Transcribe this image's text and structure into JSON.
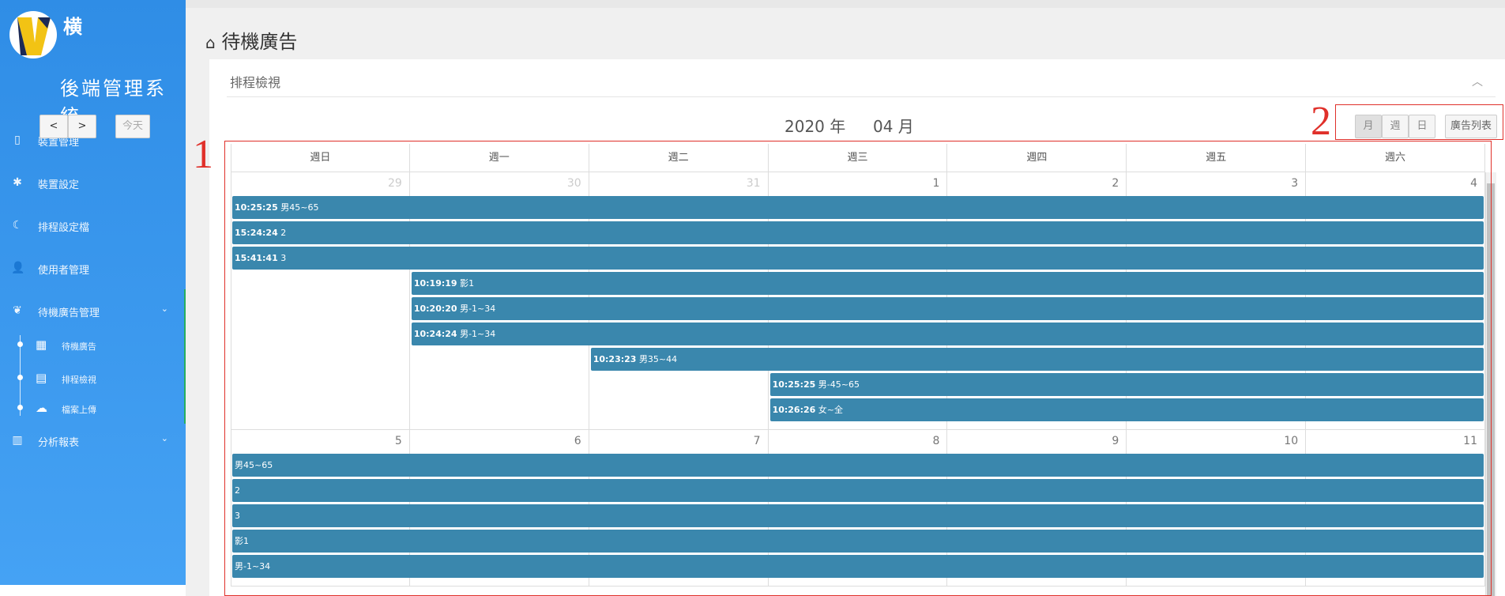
{
  "sidebar": {
    "logo_name": "横",
    "system_title": "後端管理系統",
    "menu": [
      {
        "label": "裝置管理",
        "icon": "tablet-icon"
      },
      {
        "label": "裝置設定",
        "icon": "gear-icon"
      },
      {
        "label": "排程設定檔",
        "icon": "moon-icon"
      },
      {
        "label": "使用者管理",
        "icon": "user-icon"
      },
      {
        "label": "待機廣告管理",
        "icon": "leaf-icon",
        "expanded": true
      },
      {
        "label": "分析報表",
        "icon": "bar-chart-icon"
      }
    ],
    "submenu": [
      {
        "label": "待機廣告",
        "icon": "film-icon"
      },
      {
        "label": "排程檢視",
        "icon": "calendar-icon",
        "active": true
      },
      {
        "label": "檔案上傳",
        "icon": "cloud-upload-icon"
      }
    ]
  },
  "page": {
    "title": "待機廣告"
  },
  "panel": {
    "title": "排程檢視"
  },
  "toolbar": {
    "prev": "<",
    "next": ">",
    "today": "今天",
    "year": "2020 年",
    "month": "04 月",
    "view_month": "月",
    "view_week": "週",
    "view_day": "日",
    "ad_list": "廣告列表"
  },
  "calendar": {
    "weekdays": [
      "週日",
      "週一",
      "週二",
      "週三",
      "週四",
      "週五",
      "週六"
    ],
    "weeks": [
      {
        "days": [
          "29",
          "30",
          "31",
          "1",
          "2",
          "3",
          "4"
        ],
        "events": [
          {
            "time": "10:25:25",
            "title": "男45~65",
            "start": 0
          },
          {
            "time": "15:24:24",
            "title": "2",
            "start": 0
          },
          {
            "time": "15:41:41",
            "title": "3",
            "start": 0
          },
          {
            "time": "10:19:19",
            "title": "影1",
            "start": 1
          },
          {
            "time": "10:20:20",
            "title": "男-1~34",
            "start": 1
          },
          {
            "time": "10:24:24",
            "title": "男-1~34",
            "start": 1
          },
          {
            "time": "10:23:23",
            "title": "男35~44",
            "start": 2
          },
          {
            "time": "10:25:25",
            "title": "男-45~65",
            "start": 3
          },
          {
            "time": "10:26:26",
            "title": "女~全",
            "start": 3
          }
        ]
      },
      {
        "days": [
          "5",
          "6",
          "7",
          "8",
          "9",
          "10",
          "11"
        ],
        "events": [
          {
            "time": "",
            "title": "男45~65",
            "start": 0
          },
          {
            "time": "",
            "title": "2",
            "start": 0
          },
          {
            "time": "",
            "title": "3",
            "start": 0
          },
          {
            "time": "",
            "title": "影1",
            "start": 0
          },
          {
            "time": "",
            "title": "男-1~34",
            "start": 0
          }
        ]
      }
    ]
  },
  "annotations": [
    {
      "label": "1"
    },
    {
      "label": "2"
    }
  ],
  "colors": {
    "sidebar_top": "#2f8de6",
    "sidebar_bottom": "#45a2f4",
    "event": "#3a87ad",
    "annotation": "#e0302a",
    "active_marker": "#27ae60"
  }
}
